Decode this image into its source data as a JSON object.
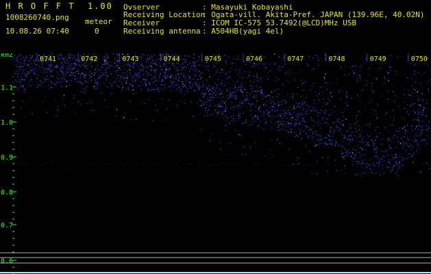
{
  "header": {
    "app_title": "H R O F F T",
    "version": "1.00",
    "file_name": "1008260740.png",
    "date_time": "10.08.26 07:40",
    "meteor_label": "meteor",
    "meteor_count": "0"
  },
  "info": {
    "observer_label": "Ovserver",
    "observer_value": ": Masayuki Kobayashi",
    "location_label": "Receiving Location",
    "location_value": ": Ogata-vill. Akita-Pref. JAPAN (139.96E, 40.02N)",
    "receiver_label": "Receiver",
    "receiver_value": ": ICOM IC-575 53.7492(@LCD)MHz USB",
    "antenna_label": "Receiving antenna",
    "antenna_value": ": A504HB(yagi 4el)"
  },
  "spectrogram": {
    "unit": "kHz",
    "time_labels": [
      "0741",
      "0742",
      "0743",
      "0744",
      "0745",
      "0746",
      "0747",
      "0748",
      "0749",
      "0750"
    ],
    "freq_ticks": [
      "1.1",
      "1.0",
      "0.9",
      "0.8",
      "0.7",
      "0.6"
    ],
    "colors": {
      "signal": "#3b4dff",
      "bright": "#a8b4ff",
      "label": "#e8e81a",
      "axis": "#22ff22",
      "ref_line": "#b0b0b0",
      "bottom_line": "#7fffff"
    }
  }
}
